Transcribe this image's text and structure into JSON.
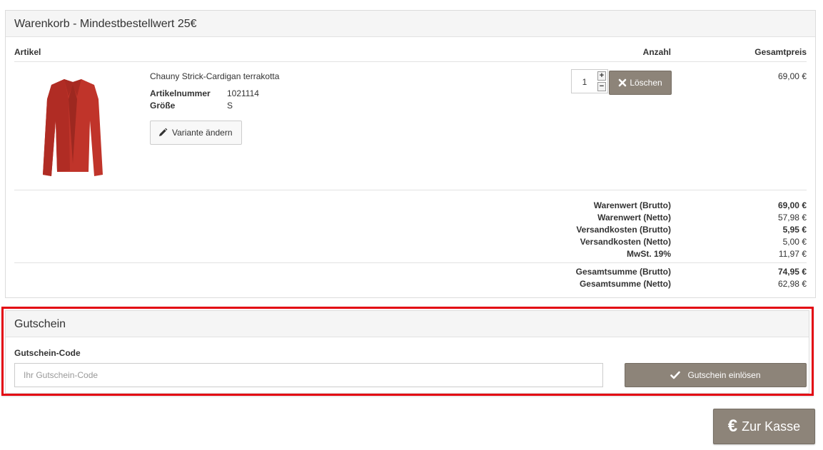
{
  "cart": {
    "title": "Warenkorb - Mindestbestellwert 25€",
    "columns": {
      "article": "Artikel",
      "quantity": "Anzahl",
      "total": "Gesamtpreis"
    },
    "item": {
      "name": "Chauny Strick-Cardigan terrakotta",
      "article_number_label": "Artikelnummer",
      "article_number": "1021114",
      "size_label": "Größe",
      "size": "S",
      "variant_button": "Variante ändern",
      "quantity": "1",
      "plus": "+",
      "minus": "−",
      "delete_button": "Löschen",
      "price": "69,00 €",
      "image_icon": "cardigan-image",
      "image_color": "#c0342a"
    },
    "summary": [
      {
        "label": "Warenwert (Brutto)",
        "value": "69,00 €",
        "bold": true
      },
      {
        "label": "Warenwert (Netto)",
        "value": "57,98 €",
        "bold": false
      },
      {
        "label": "Versandkosten (Brutto)",
        "value": "5,95 €",
        "bold": true
      },
      {
        "label": "Versandkosten (Netto)",
        "value": "5,00 €",
        "bold": false
      },
      {
        "label": "MwSt. 19%",
        "value": "11,97 €",
        "bold": false
      }
    ],
    "totals": [
      {
        "label": "Gesamtsumme (Brutto)",
        "value": "74,95 €",
        "bold": true
      },
      {
        "label": "Gesamtsumme (Netto)",
        "value": "62,98 €",
        "bold": false
      }
    ]
  },
  "voucher": {
    "title": "Gutschein",
    "code_label": "Gutschein-Code",
    "placeholder": "Ihr Gutschein-Code",
    "redeem_button": "Gutschein einlösen",
    "highlight_color": "#e30613"
  },
  "checkout": {
    "button_label": "Zur Kasse",
    "icon": "euro-icon"
  },
  "colors": {
    "button_bg": "#8d8479",
    "panel_head_bg": "#f5f5f5"
  }
}
